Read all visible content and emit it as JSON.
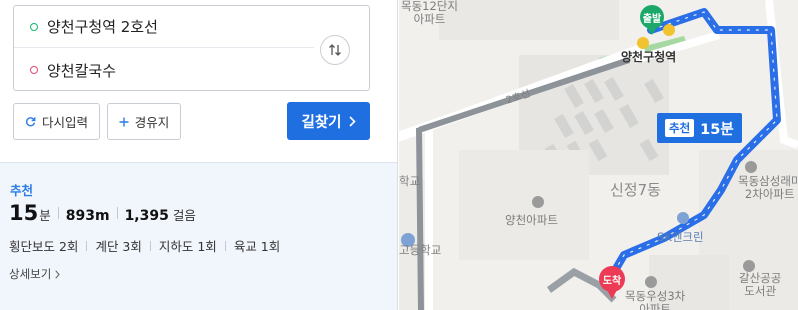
{
  "search": {
    "start": "양천구청역 2호선",
    "end": "양천칼국수"
  },
  "buttons": {
    "reset": "다시입력",
    "via": "경유지",
    "search": "길찾기"
  },
  "result": {
    "label": "추천",
    "minutes": "15",
    "minutes_unit": "분",
    "distance": "893m",
    "steps": "1,395",
    "steps_unit": "걸음",
    "details": [
      "횡단보도 2회",
      "계단 3회",
      "지하도 1회",
      "육교 1회"
    ],
    "more": "상세보기"
  },
  "map": {
    "badge_label": "추천",
    "badge_time": "15분",
    "start_pin": "출발",
    "end_pin": "도착",
    "labels": {
      "apt12": "목동12단지\n아파트",
      "station": "양천구청역",
      "line2": "2호선",
      "district": "신정7동",
      "yangcheon_apt": "양천아파트",
      "sk": "SK엔크린",
      "mokdong_samsung": "목동삼성래미\n2차아파트",
      "library": "갈산공공\n도서관",
      "woosung": "목동우성3차\n아파트",
      "school": "고등학교",
      "school_top": "학교"
    }
  },
  "colors": {
    "accent": "#1f6fe0",
    "route": "#2a6ee8",
    "start": "#1ca868",
    "end": "#ec3b55"
  }
}
